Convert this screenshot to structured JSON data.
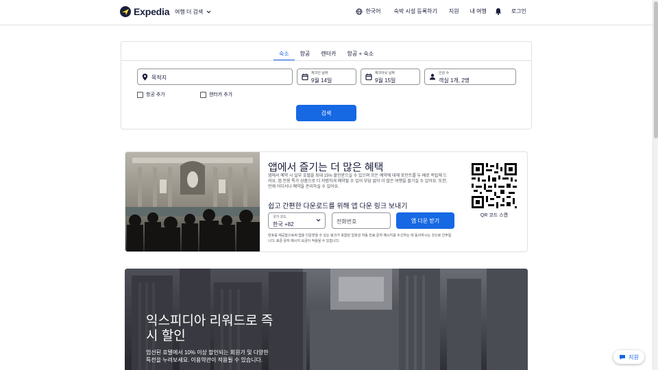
{
  "header": {
    "brand": "Expedia",
    "more_travel": "여행 더 검색",
    "language": "한국어",
    "list_property": "숙박 시설 등록하기",
    "support": "지원",
    "trips": "내 여행",
    "sign_in": "로그인"
  },
  "search": {
    "tabs": [
      {
        "label": "숙소",
        "active": true
      },
      {
        "label": "항공",
        "active": false
      },
      {
        "label": "렌터카",
        "active": false
      },
      {
        "label": "항공 + 숙소",
        "active": false
      }
    ],
    "destination_placeholder": "목적지",
    "checkin": {
      "label": "체크인 날짜",
      "value": "9월 14일"
    },
    "checkout": {
      "label": "체크아웃 날짜",
      "value": "9월 15일"
    },
    "travelers": {
      "label": "인원 수",
      "value": "객실 1개, 2명"
    },
    "add_flight": "항공 추가",
    "add_car": "렌터카 추가",
    "search_button": "검색"
  },
  "app_promo": {
    "title": "앱에서 즐기는 더 많은 혜택",
    "body": "앱에서 예약 시 일부 호텔을 최대 15% 할인받으실 수 있으며 모든 예약에 대해 포인트를 두 배로 적립해 드려요. 앱 전용 특가 상품으로 더 저렴하게 예약할 수 있어 부담 없이 더 많은 여행을 즐기실 수 있어요. 또한, 언제 어디서나 예약을 관리하실 수 있어요.",
    "subtitle": "쉽고 간편한 다운로드를 위해 앱 다운 링크 보내기",
    "country_code_label": "국가 코드",
    "country_code_value": "한국 +82",
    "phone_placeholder": "전화번호",
    "get_link_button": "앱 다운 받기",
    "legal": "번호를 제공함으로써 앱을 다운받을 수 있는 링크가 포함된 일회성 자동 전송 문자 메시지를 수신하는 데 동의하시는 것으로 간주됩니다. 표준 문자 메시지 요금이 적용될 수 있습니다.",
    "qr_label": "QR 코드 스캔"
  },
  "rewards": {
    "title": "익스피디아 리워드로 즉시 할인",
    "body": "엄선된 호텔에서 10% 이상 할인되는 회원가 및 다양한 특전을 누려보세요. 이용약관이 적용될 수 있습니다."
  },
  "help_fab": {
    "label": "지원"
  },
  "colors": {
    "primary": "#1668e3",
    "brand_navy": "#191e3b",
    "border": "#dfe0e4"
  }
}
